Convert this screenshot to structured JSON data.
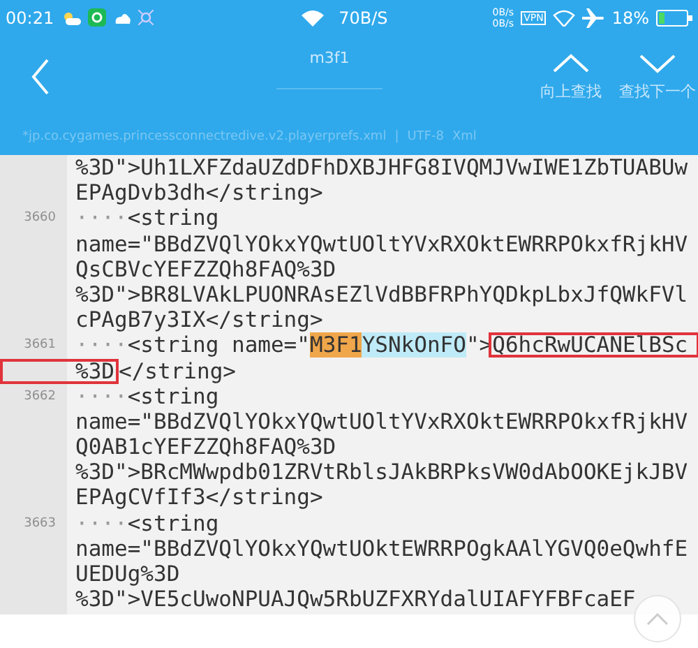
{
  "status_bar": {
    "time": "00:21",
    "net_speed": "70B/S",
    "up_speed": "0B/s",
    "down_speed": "0B/s",
    "vpn": "VPN",
    "battery_text": "18%"
  },
  "toolbar": {
    "search_value": "m3f1",
    "actions": [
      {
        "kind": "up",
        "label": "向上查找"
      },
      {
        "kind": "down",
        "label": "查找下一个"
      }
    ]
  },
  "file_info": {
    "filename": "*jp.co.cygames.princessconnectredive.v2.playerprefs.xml",
    "separator": "|",
    "encoding": "UTF-8",
    "syntax": "Xml"
  },
  "editor": {
    "rows": [
      {
        "segments": [
          {
            "kind": "plain",
            "text": "%3D\">Uh1LXFZdaUZdDFhDXBJHFG8IVQMJVwIWE1ZbTUABUw"
          }
        ]
      },
      {
        "segments": [
          {
            "kind": "plain",
            "text": "EPAgDvb3dh</string>"
          }
        ]
      },
      {
        "number": "3660",
        "segments": [
          {
            "kind": "whitespace",
            "text": "····"
          },
          {
            "kind": "plain",
            "text": "<string"
          }
        ]
      },
      {
        "segments": [
          {
            "kind": "plain",
            "text": "name=\"BBdZVQlYOkxYQwtUOltYVxRXOktEWRRPOkxfRjkHV"
          }
        ]
      },
      {
        "segments": [
          {
            "kind": "plain",
            "text": "QsCBVcYEFZZQh8FAQ%3D"
          }
        ]
      },
      {
        "segments": [
          {
            "kind": "plain",
            "text": "%3D\">BR8LVAkLPUONRAsEZlVdBBFRPhYQDkpLbxJfQWkFVl"
          }
        ]
      },
      {
        "segments": [
          {
            "kind": "plain",
            "text": "cPAgB7y3IX</string>"
          }
        ]
      },
      {
        "number": "3661",
        "segments": [
          {
            "kind": "whitespace",
            "text": "····"
          },
          {
            "kind": "plain",
            "text": "<string name=\""
          },
          {
            "kind": "match",
            "text": "M3F1"
          },
          {
            "kind": "match_rest",
            "text": "YSNkOnFO"
          },
          {
            "kind": "plain",
            "text": "\">"
          },
          {
            "kind": "boxed",
            "text": "Q6hcRwUCANElBSc"
          }
        ]
      },
      {
        "segments": [
          {
            "kind": "boxed_left",
            "text": "%3D"
          },
          {
            "kind": "plain",
            "text": "</string>"
          }
        ]
      },
      {
        "number": "3662",
        "segments": [
          {
            "kind": "whitespace",
            "text": "····"
          },
          {
            "kind": "plain",
            "text": "<string"
          }
        ]
      },
      {
        "segments": [
          {
            "kind": "plain",
            "text": "name=\"BBdZVQlYOkxYQwtUOltYVxRXOktEWRRPOkxfRjkHV"
          }
        ]
      },
      {
        "segments": [
          {
            "kind": "plain",
            "text": "Q0AB1cYEFZZQh8FAQ%3D"
          }
        ]
      },
      {
        "segments": [
          {
            "kind": "plain",
            "text": "%3D\">BRcMWwpdb01ZRVtRblsJAkBRPksVW0dAbOOKEjkJBV"
          }
        ]
      },
      {
        "segments": [
          {
            "kind": "plain",
            "text": "EPAgCVfIf3</string>"
          }
        ]
      },
      {
        "number": "3663",
        "segments": [
          {
            "kind": "whitespace",
            "text": "····"
          },
          {
            "kind": "plain",
            "text": "<string"
          }
        ]
      },
      {
        "segments": [
          {
            "kind": "plain",
            "text": "name=\"BBdZVQlYOkxYQwtUOktEWRRPOgkAAlYGVQ0eQwhfE"
          }
        ]
      },
      {
        "segments": [
          {
            "kind": "plain",
            "text": "UEDUg%3D"
          }
        ]
      },
      {
        "segments": [
          {
            "kind": "plain",
            "text": "%3D\">VE5cUwoNPUAJQw5RbUZFXRYdalUIAFYFBFcaEF"
          }
        ]
      }
    ]
  }
}
